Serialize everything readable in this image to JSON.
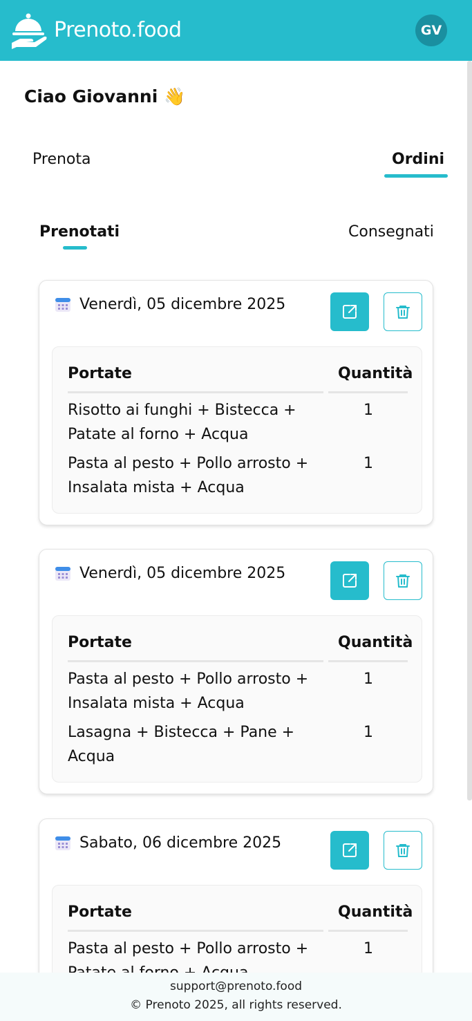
{
  "app": {
    "brand": "Prenoto.food",
    "avatar_initials": "GV",
    "accent": "#26bccc"
  },
  "greeting": {
    "text": "Ciao Giovanni",
    "emoji": "👋"
  },
  "main_tabs": [
    {
      "label": "Prenota",
      "active": false
    },
    {
      "label": "Ordini",
      "active": true
    }
  ],
  "sub_tabs": [
    {
      "label": "Prenotati",
      "active": true
    },
    {
      "label": "Consegnati",
      "active": false
    }
  ],
  "table_headers": {
    "dishes": "Portate",
    "quantity": "Quantità"
  },
  "orders": [
    {
      "date": "Venerdì, 05 dicembre 2025",
      "rows": [
        {
          "dish": "Risotto ai funghi + Bistecca + Patate al forno + Acqua",
          "qty": "1"
        },
        {
          "dish": "Pasta al pesto + Pollo arrosto + Insalata mista + Acqua",
          "qty": "1"
        }
      ]
    },
    {
      "date": "Venerdì, 05 dicembre 2025",
      "rows": [
        {
          "dish": "Pasta al pesto + Pollo arrosto + Insalata mista + Acqua",
          "qty": "1"
        },
        {
          "dish": "Lasagna + Bistecca + Pane + Acqua",
          "qty": "1"
        }
      ]
    },
    {
      "date": "Sabato, 06 dicembre 2025",
      "rows": [
        {
          "dish": "Pasta al pesto + Pollo arrosto + Patate al forno + Acqua",
          "qty": "1"
        }
      ]
    }
  ],
  "footer": {
    "email": "support@prenoto.food",
    "copyright": "© Prenoto 2025, all rights reserved."
  }
}
